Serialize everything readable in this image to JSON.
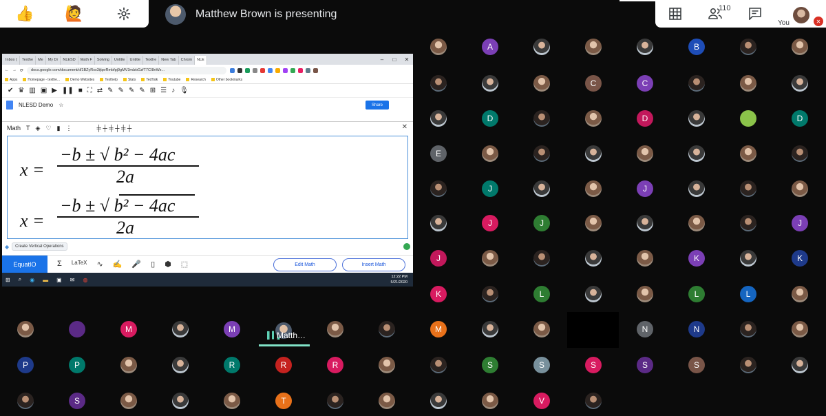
{
  "header": {
    "presenting_text": "Matthew Brown is presenting",
    "participant_count": "110",
    "you_label": "You"
  },
  "icons": {
    "top_left": [
      "thumbs-up-icon",
      "raise-hand-icon",
      "settings-icon"
    ],
    "top_right": [
      "grid-icon",
      "people-icon",
      "chat-icon"
    ]
  },
  "presentation": {
    "browser_tabs": [
      "Inbox (",
      "Texthe",
      "Me",
      "My Dr",
      "NLESD",
      "Math F",
      "Solving",
      "Untitle",
      "Untitle",
      "Texthe",
      "New Tab",
      "Chrom",
      "NLE"
    ],
    "url": "docs.google.com/document/d/1BZyRxx3ijtpvRmbfpj9gMV3mlzbGzfT7CI8nWz...",
    "bookmarks": [
      "Apps",
      "Homepage - texthe...",
      "Demo Websites",
      "Texthelp",
      "Stats",
      "TedTalk",
      "Youtube",
      "Research",
      "Other bookmarks"
    ],
    "doc_title": "NLESD Demo",
    "share_label": "Share",
    "math_title": "Math",
    "equation_lhs": "x =",
    "equation_numerator": "−b ± √ b² − 4ac",
    "equation_denominator": "2a",
    "create_vertical_label": "Create Vertical Operations",
    "equatio_logo": "EquatIO",
    "edit_math_label": "Edit Math",
    "insert_math_label": "Insert Math",
    "clock_time": "12:22 PM",
    "clock_date": "5/21/2020"
  },
  "presenter_tile": {
    "name": "Matth…"
  },
  "participants": {
    "colors": {
      "purple": "#7b3fb5",
      "blue": "#1a73e8",
      "pink": "#d81b60",
      "green": "#2e7d32",
      "teal": "#00796b",
      "gray": "#5f6368",
      "brown": "#795548",
      "red": "#c5221f",
      "navy": "#1e3a8a",
      "orange": "#e8711a",
      "magenta": "#c2185b",
      "lightblue": "#1565c0"
    },
    "letters": {
      "A": "A",
      "B": "B",
      "C": "C",
      "D": "D",
      "E": "E",
      "J": "J",
      "K": "K",
      "L": "L",
      "M": "M",
      "N": "N",
      "P": "P",
      "R": "R",
      "S": "S",
      "T": "T",
      "V": "V"
    }
  }
}
